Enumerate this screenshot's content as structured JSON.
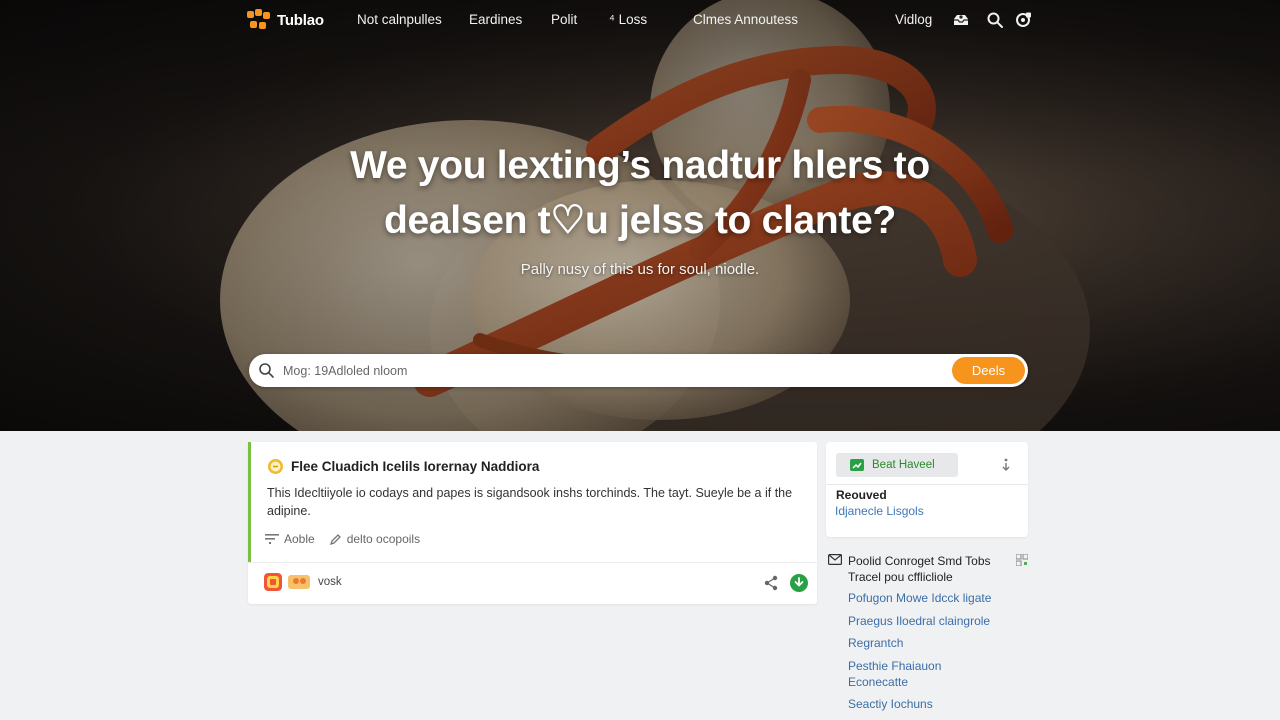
{
  "nav": {
    "brand": "Tublao",
    "links": [
      "Not calnpulles",
      "Eardines",
      "Polit",
      "Loss",
      "Clmes Annoutess"
    ],
    "loss_prefix": "⁴",
    "user_link": "Vidlog",
    "icons": [
      "inbox-icon",
      "search-icon",
      "settings-icon"
    ]
  },
  "hero": {
    "headline_line1": "We you lexting’s nadtur hlers to",
    "headline_line2": "dealsen t♡u jelss to clante?",
    "subline": "Pally nusy of this us for soul, niodle.",
    "search_placeholder": "Mog: 19Adloled nloom",
    "search_button": "Deels"
  },
  "card": {
    "title": "Flee Cluadich Icelils Iorernay Naddiora",
    "description": "This Idecltiiyole io codays and papes is sigandsook inshs torchinds. The tayt. Sueyle be a if the adipine.",
    "meta_label": "Aoble",
    "meta_link": "delto ocopoils",
    "footer_text": "vosk"
  },
  "sidebar": {
    "button_label": "Beat Haveel",
    "section_label": "Reouved",
    "link_text": "Idjanecle Lisgols",
    "related_title": "Poolid Conroget Smd Tobs Tracel pou cfflicliole",
    "related_links": [
      "Pofugon Mowe Idcck ligate",
      "Praegus Iloedral claingrole",
      "Regrantch",
      "Pesthie Fhaiauon Econecatte",
      "Seactiy Iochuns"
    ]
  },
  "colors": {
    "accent_orange": "#f7941d",
    "accent_green": "#7ac143",
    "link_blue": "#3b6ea8",
    "button_green_text": "#2a8a2a"
  }
}
